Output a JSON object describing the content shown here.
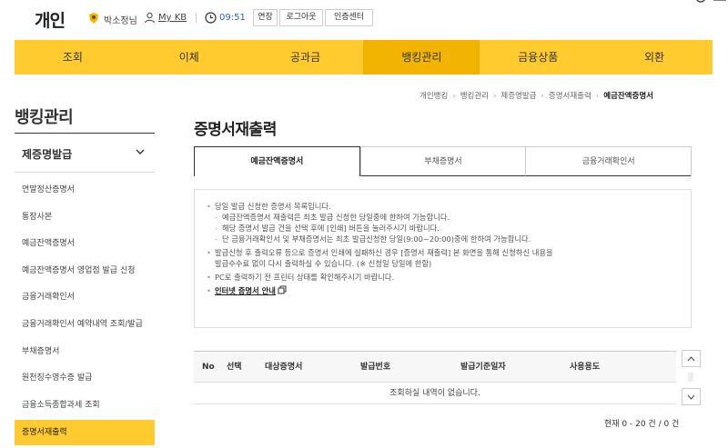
{
  "header": {
    "brand": "개인",
    "user_name": "박소정님",
    "mykb": "My KB",
    "timer": "09:51",
    "buttons": {
      "extend": "연장",
      "logout": "로그아웃",
      "cert": "인증센터"
    }
  },
  "gnb": [
    {
      "label": "조회"
    },
    {
      "label": "이체"
    },
    {
      "label": "공과금"
    },
    {
      "label": "뱅킹관리"
    },
    {
      "label": "금융상품"
    },
    {
      "label": "외환"
    }
  ],
  "lnb": {
    "title": "뱅킹관리",
    "section": "제증명발급",
    "items": [
      "연말정산증명서",
      "통장사본",
      "예금잔액증명서",
      "예금잔액증명서 영업점 발급 신청",
      "금융거래확인서",
      "금융거래확인서 예약내역 조회/발급",
      "부채증명서",
      "원천징수영수증 발급",
      "금융소득종합과세 조회"
    ],
    "active_item": "증명서재출력"
  },
  "breadcrumb": [
    "개인뱅킹",
    "뱅킹관리",
    "제증명발급",
    "증명서재출력",
    "예금잔액증명서"
  ],
  "page_title": "증명서재출력",
  "tabs": [
    "예금잔액증명서",
    "부채증명서",
    "금융거래확인서"
  ],
  "notice": {
    "l1": "당일 발급 신청한 증명서 목록입니다.",
    "l2": "예금잔액증명서 재출력은 최초 발급 신청한 당일중에 한하여 가능합니다.",
    "l3": "해당 증명서 발급 건을 선택 후에 [인쇄] 버튼을 눌러주시기 바랍니다.",
    "l4": "단 금융거래확인서 및 부채증명서는 최초 발급신청한 당일(9:00~20:00)중에 한하여 가능합니다.",
    "l5": "발급신청 후 출력오류 등으로 증명서 인쇄에 실패하신 경우 [증명서 재출력] 본 화면을 통해 신청하신 내용을",
    "l6": "발급수수료 없이 다시 출력하실 수 있습니다. (※ 신청일 당일에 한함)",
    "l7": "PC로 출력하기 전 프린터 상태를 확인해주시기 바랍니다.",
    "link": "인터넷 증명서 안내"
  },
  "table": {
    "headers": [
      "No",
      "선택",
      "대상증명서",
      "발급번호",
      "발급기준일자",
      "사용용도"
    ],
    "empty_message": "조회하실 내역이 없습니다."
  },
  "count": "현재 0 - 20 건 / 0 건",
  "colors": {
    "accent": "#ffcb2f",
    "accent_active": "#f3b400",
    "timer": "#2a64c8"
  }
}
